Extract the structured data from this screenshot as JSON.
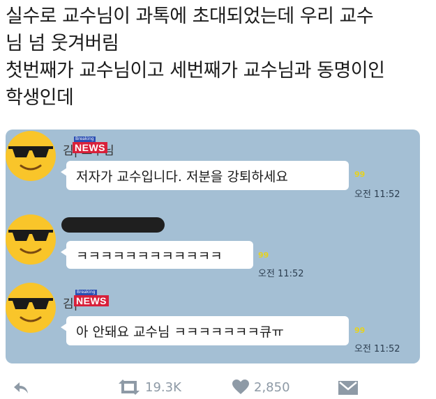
{
  "tweet": {
    "lines": [
      "실수로 교수님이 과톡에 초대되었는데 우리 교수",
      "님 넘 웃겨버림",
      "첫번째가 교수님이고 세번째가 교수님과 동명이인",
      "학생인데"
    ]
  },
  "chat": {
    "messages": [
      {
        "sender": "김|  교수님",
        "badge_top": "Breaking",
        "badge_text": "NEWS",
        "text": "저자가 교수입니다. 저분을 강퇴하세요",
        "unread": "99",
        "time": "오전 11:52"
      },
      {
        "sender": "",
        "text": "ㅋㅋㅋㅋㅋㅋㅋㅋㅋㅋㅋㅋ",
        "unread": "99",
        "time": "오전 11:52"
      },
      {
        "sender": "김|",
        "badge_top": "Breaking",
        "badge_text": "NEWS",
        "text": "아 안돼요 교수님 ㅋㅋㅋㅋㅋㅋㅋ큐ㅠ",
        "unread": "99",
        "time": "오전 11:52"
      }
    ]
  },
  "actions": {
    "retweet_count": "19.3K",
    "like_count": "2,850"
  },
  "colors": {
    "chat_bg": "#a4bfd4",
    "avatar": "#f9c52a",
    "unread": "#e6d21f",
    "action_icon": "#8e9aa6"
  }
}
